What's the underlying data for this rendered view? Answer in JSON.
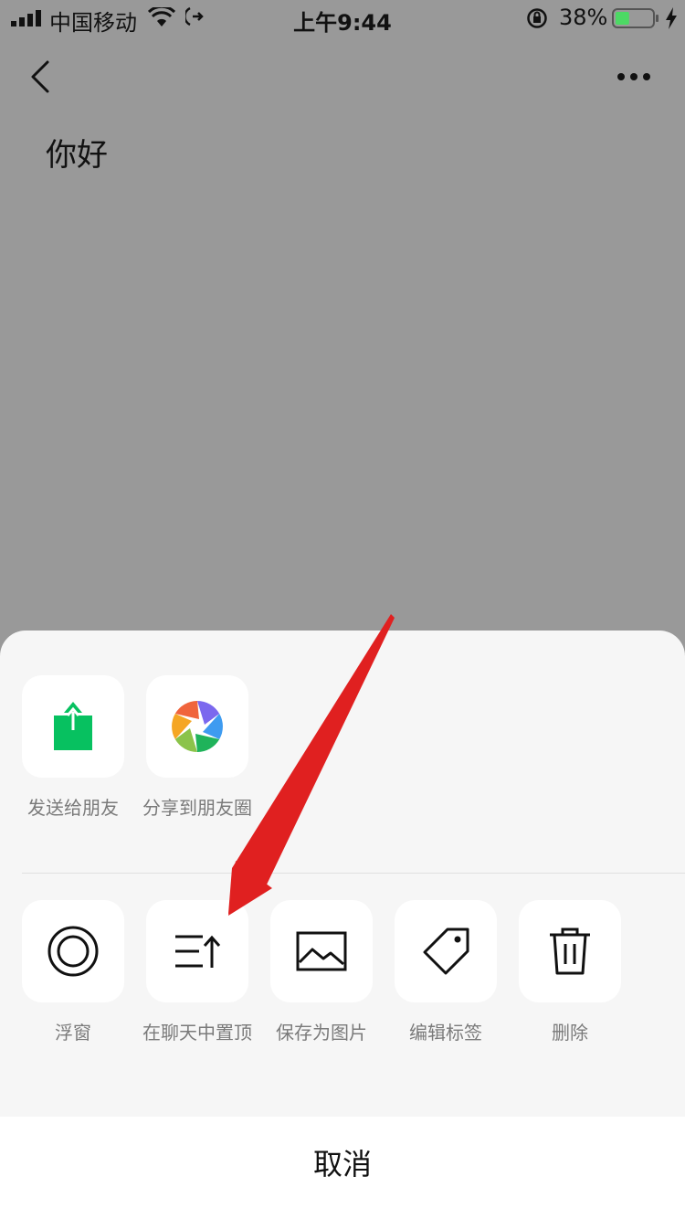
{
  "status_bar": {
    "carrier": "中国移动",
    "time": "上午9:44",
    "battery_percent": "38%",
    "battery_level": 0.38,
    "icons": [
      "signal-icon",
      "wifi-icon",
      "call-forward-icon",
      "orientation-lock-icon",
      "battery-icon",
      "charging-icon"
    ]
  },
  "nav": {
    "back_icon": "chevron-left-icon",
    "more_icon": "more-dots-icon"
  },
  "note": {
    "text": "你好"
  },
  "sheet": {
    "share_actions": [
      {
        "label": "发送给朋友",
        "icon": "share-to-friend-icon"
      },
      {
        "label": "分享到朋友圈",
        "icon": "moments-aperture-icon"
      }
    ],
    "more_actions": [
      {
        "label": "浮窗",
        "icon": "float-window-icon"
      },
      {
        "label": "在聊天中置顶",
        "icon": "pin-to-top-icon"
      },
      {
        "label": "保存为图片",
        "icon": "image-icon"
      },
      {
        "label": "编辑标签",
        "icon": "tag-icon"
      },
      {
        "label": "删除",
        "icon": "trash-icon"
      }
    ],
    "cancel_label": "取消"
  },
  "colors": {
    "overlay": "#999999",
    "sheet_bg": "#f6f6f6",
    "tile_bg": "#ffffff",
    "wechat_green": "#07c160",
    "battery_green": "#4cd964",
    "annotation_red": "#e02020"
  }
}
